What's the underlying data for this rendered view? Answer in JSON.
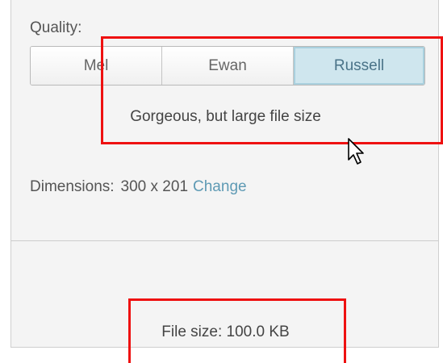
{
  "quality": {
    "label": "Quality:",
    "options": [
      "Mel",
      "Ewan",
      "Russell"
    ],
    "selected": "Russell",
    "description": "Gorgeous, but large file size"
  },
  "dimensions": {
    "label": "Dimensions:",
    "value": "300 x 201",
    "change_link": "Change"
  },
  "file_size": {
    "text": "File size: 100.0 KB"
  },
  "colors": {
    "accent": "#cfe6ee",
    "link": "#5e9ab4",
    "highlight": "#ee1111"
  },
  "icons": {
    "cursor": "mouse-pointer-icon"
  }
}
